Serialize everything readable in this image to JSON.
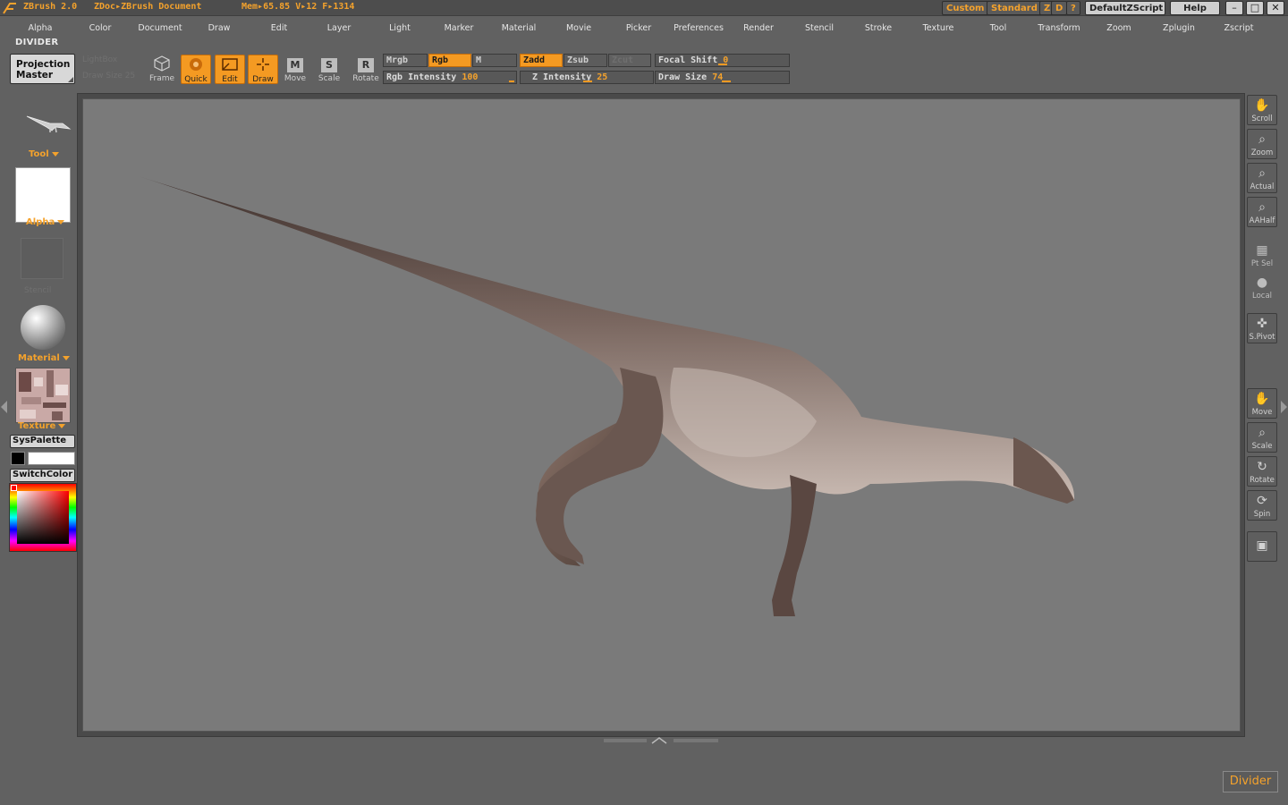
{
  "titlebar": {
    "app": "ZBrush 2.0",
    "doc": "ZDoc▸ZBrush Document",
    "mem": "Mem▸65.85 V▸12 F▸1314",
    "custom": "Custom",
    "standard": "Standard",
    "z": "Z",
    "d": "D",
    "help_q": "?",
    "zscript": "DefaultZScript",
    "help": "Help",
    "win_min": "–",
    "win_max": "□",
    "win_close": "✕"
  },
  "menu": [
    "Alpha",
    "Color",
    "Document",
    "Draw",
    "Edit",
    "Layer",
    "Light",
    "Marker",
    "Material",
    "Movie",
    "Picker",
    "Preferences",
    "Render",
    "Stencil",
    "Stroke",
    "Texture",
    "Tool",
    "Transform",
    "Zoom",
    "Zplugin",
    "Zscript"
  ],
  "divider_label": "DIVIDER",
  "projection_master": {
    "line1": "Projection",
    "line2": "Master"
  },
  "ghost": {
    "lightbox": "LightBox",
    "d_size": "Draw Size 25"
  },
  "toolbar": {
    "frame": "Frame",
    "quick": "Quick",
    "edit": "Edit",
    "draw": "Draw",
    "move": "Move",
    "scale": "Scale",
    "rotate": "Rotate",
    "mrgb": "Mrgb",
    "rgb": "Rgb",
    "m": "M",
    "zadd": "Zadd",
    "zsub": "Zsub",
    "zcut": "Zcut",
    "rgb_intensity_label": "Rgb Intensity",
    "rgb_intensity": "100",
    "z_intensity_label": "Z Intensity",
    "z_intensity": "25",
    "focal_shift_label": "Focal Shift",
    "focal_shift": "0",
    "draw_size_label": "Draw Size",
    "draw_size": "74"
  },
  "left": {
    "tool": "Tool",
    "alpha": "Alpha",
    "stencil_ghost": "Stencil",
    "material": "Material",
    "texture": "Texture",
    "syspalette": "SysPalette",
    "switchcolor": "SwitchColor"
  },
  "right": [
    {
      "label": "Scroll",
      "icon": "hand-icon"
    },
    {
      "label": "Zoom",
      "icon": "zoom-icon"
    },
    {
      "label": "Actual",
      "icon": "actual-icon"
    },
    {
      "label": "AAHalf",
      "icon": "aahalf-icon"
    },
    {
      "label": "Pt Sel",
      "icon": "grid-icon"
    },
    {
      "label": "Local",
      "icon": "local-icon"
    },
    {
      "label": "S.Pivot",
      "icon": "pivot-icon"
    },
    {
      "label": "Move",
      "icon": "move-icon"
    },
    {
      "label": "Scale",
      "icon": "scale-icon"
    },
    {
      "label": "Rotate",
      "icon": "rotate-icon"
    },
    {
      "label": "Spin",
      "icon": "spin-icon"
    }
  ],
  "divider_button": "Divider",
  "colors": {
    "accent": "#f49a22",
    "canvas": "#7a7a7a",
    "ui": "#616161"
  }
}
